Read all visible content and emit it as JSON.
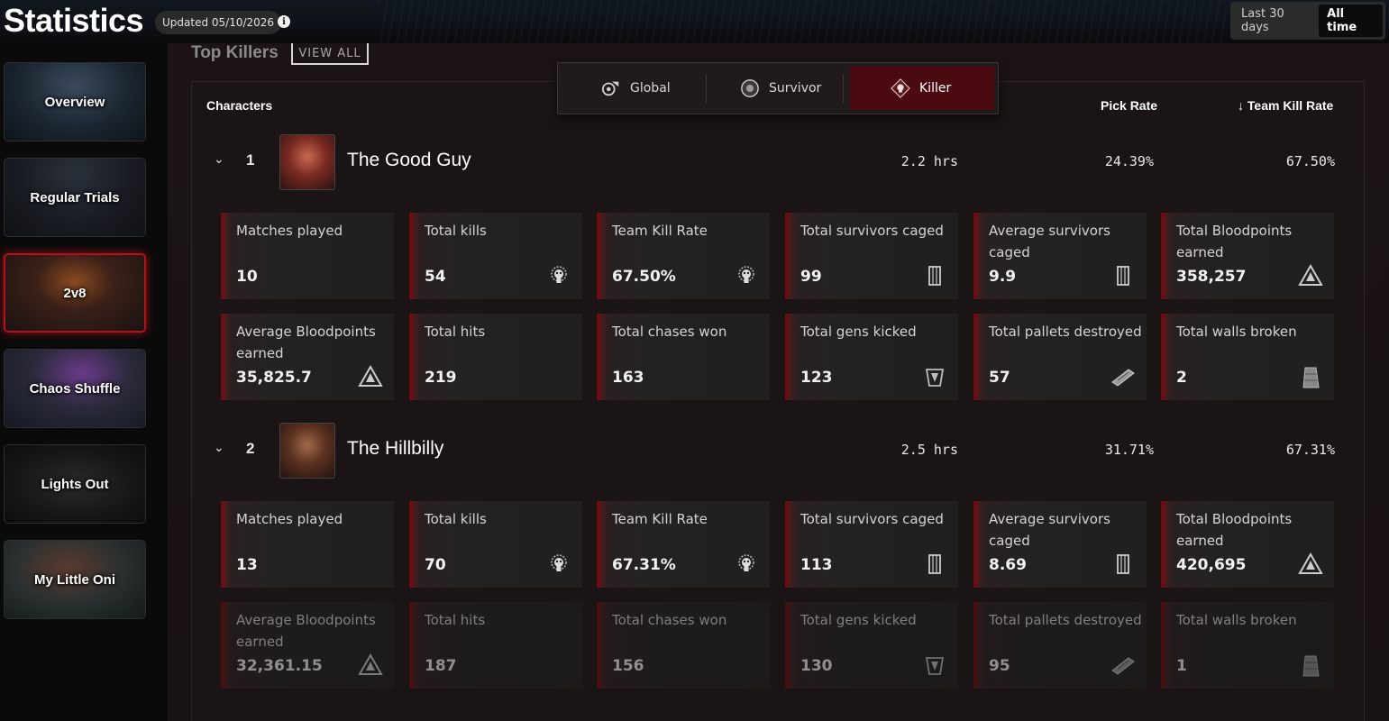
{
  "header": {
    "title": "Statistics",
    "updated": "Updated 05/10/2026",
    "range_options": [
      "Last 30 days",
      "All time"
    ],
    "active_range": "All time"
  },
  "sidebar": {
    "items": [
      {
        "label": "Overview"
      },
      {
        "label": "Regular Trials"
      },
      {
        "label": "2v8",
        "active": true
      },
      {
        "label": "Chaos Shuffle"
      },
      {
        "label": "Lights Out"
      },
      {
        "label": "My Little Oni"
      }
    ]
  },
  "main": {
    "section_title": "Top Killers",
    "view_all": "VIEW ALL",
    "role_tabs": [
      {
        "label": "Global",
        "icon": "global-icon"
      },
      {
        "label": "Survivor",
        "icon": "survivor-icon"
      },
      {
        "label": "Killer",
        "icon": "killer-icon",
        "active": true
      }
    ],
    "columns": {
      "characters": "Characters",
      "pick_rate": "Pick Rate",
      "team_kill_rate": "Team Kill Rate"
    },
    "characters": [
      {
        "rank": "1",
        "name": "The Good Guy",
        "time": "2.2 hrs",
        "pick_rate": "24.39%",
        "team_kill_rate": "67.50%",
        "stats": [
          {
            "label": "Matches played",
            "value": "10",
            "icon": ""
          },
          {
            "label": "Total kills",
            "value": "54",
            "icon": "skull-icon"
          },
          {
            "label": "Team Kill Rate",
            "value": "67.50%",
            "icon": "skull-icon"
          },
          {
            "label": "Total survivors caged",
            "value": "99",
            "icon": "cage-icon"
          },
          {
            "label": "Average survivors caged",
            "value": "9.9",
            "icon": "cage-icon"
          },
          {
            "label": "Total Bloodpoints earned",
            "value": "358,257",
            "icon": "bloodpoints-icon"
          },
          {
            "label": "Average Bloodpoints earned",
            "value": "35,825.7",
            "icon": "bloodpoints-icon"
          },
          {
            "label": "Total hits",
            "value": "219",
            "icon": ""
          },
          {
            "label": "Total chases won",
            "value": "163",
            "icon": ""
          },
          {
            "label": "Total gens kicked",
            "value": "123",
            "icon": "generator-icon"
          },
          {
            "label": "Total pallets destroyed",
            "value": "57",
            "icon": "pallet-icon"
          },
          {
            "label": "Total walls broken",
            "value": "2",
            "icon": "wall-icon"
          }
        ]
      },
      {
        "rank": "2",
        "name": "The Hillbilly",
        "time": "2.5 hrs",
        "pick_rate": "31.71%",
        "team_kill_rate": "67.31%",
        "stats": [
          {
            "label": "Matches played",
            "value": "13",
            "icon": ""
          },
          {
            "label": "Total kills",
            "value": "70",
            "icon": "skull-icon"
          },
          {
            "label": "Team Kill Rate",
            "value": "67.31%",
            "icon": "skull-icon"
          },
          {
            "label": "Total survivors caged",
            "value": "113",
            "icon": "cage-icon"
          },
          {
            "label": "Average survivors caged",
            "value": "8.69",
            "icon": "cage-icon"
          },
          {
            "label": "Total Bloodpoints earned",
            "value": "420,695",
            "icon": "bloodpoints-icon"
          },
          {
            "label": "Average Bloodpoints earned",
            "value": "32,361.15",
            "icon": "bloodpoints-icon"
          },
          {
            "label": "Total hits",
            "value": "187",
            "icon": ""
          },
          {
            "label": "Total chases won",
            "value": "156",
            "icon": ""
          },
          {
            "label": "Total gens kicked",
            "value": "130",
            "icon": "generator-icon"
          },
          {
            "label": "Total pallets destroyed",
            "value": "95",
            "icon": "pallet-icon"
          },
          {
            "label": "Total walls broken",
            "value": "1",
            "icon": "wall-icon"
          }
        ]
      }
    ]
  },
  "colors": {
    "accent": "#b3121a",
    "active_tab": "#4a0a10",
    "panel": "#1a1414"
  }
}
